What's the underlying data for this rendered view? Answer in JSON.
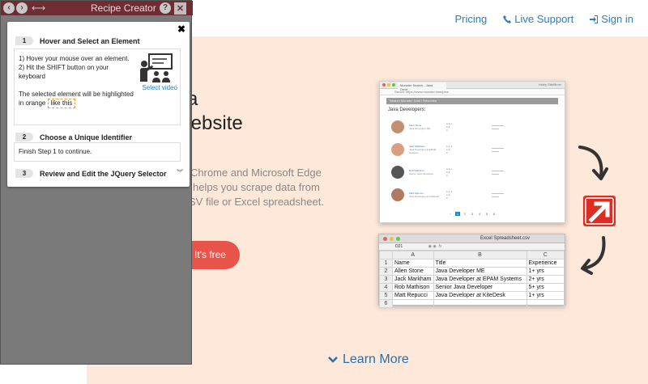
{
  "nav": {
    "pricing": "Pricing",
    "live_support": "Live Support",
    "sign_in": "Sign in"
  },
  "hero": {
    "title_line1": "a",
    "title_line2": "Vebsite",
    "title_line3": ".",
    "sub_line1": "Chrome and Microsoft Edge",
    "sub_line2": "helps you scrape data from",
    "sub_line3": "SV file or Excel spreadsheet.",
    "cta": "It's free",
    "learn_more": "Learn More"
  },
  "mock_browser": {
    "tab": "Monster Search - Java Deve...",
    "tab_right": "Haley SiteMiner",
    "url": "Secure https://www.monster.com/jobs",
    "search": "Search Monster Jobs / Resumes",
    "heading": "Java Developers:",
    "rows": [
      {
        "name": "Allen Stone",
        "title": "Java Developer ME"
      },
      {
        "name": "Jack Markham",
        "title": "Java Developer at EPAM Systems"
      },
      {
        "name": "Rob Mathison",
        "title": "Senior Java Developer"
      },
      {
        "name": "Matt Repucci",
        "title": "Java Developer at KiteDesk"
      }
    ],
    "pages": [
      "1",
      "2",
      "3",
      "4",
      "5",
      "6"
    ]
  },
  "spreadsheet": {
    "window_title": "Excel Spreadsheet.csv",
    "cell_ref": "D21",
    "col_headers": [
      "A",
      "B",
      "C"
    ],
    "rows": [
      {
        "n": "1",
        "a": "Name",
        "b": "Title",
        "c": "Experience"
      },
      {
        "n": "2",
        "a": "Allen Stone",
        "b": "Java Developer ME",
        "c": "1+ yrs"
      },
      {
        "n": "3",
        "a": "Jack Markham",
        "b": "Java Developer at EPAM Systems",
        "c": "2+ yrs"
      },
      {
        "n": "4",
        "a": "Rob Mathison",
        "b": "Senior Java Developer",
        "c": "5+ yrs"
      },
      {
        "n": "5",
        "a": "Matt Repucci",
        "b": "Java Developer at KiteDesk",
        "c": "1+ yrs"
      },
      {
        "n": "6",
        "a": "",
        "b": "",
        "c": ""
      }
    ]
  },
  "recipe_creator": {
    "title": "Recipe Creator",
    "help": "?",
    "step1": {
      "num": "1",
      "heading": "Hover and Select an Element",
      "line1": "1) Hover your mouse over an element.",
      "line2": "2) Hit the SHIFT button on your",
      "line3": "keyboard",
      "line4": "The selected element will be highlighted",
      "line5_pre": "in orange",
      "line5_hl": "like this",
      "select_video": "Select video"
    },
    "step2": {
      "num": "2",
      "heading": "Choose a Unique Identifier",
      "text": "Finish Step 1 to continue."
    },
    "step3": {
      "num": "3",
      "heading": "Review and Edit the JQuery Selector"
    }
  },
  "colors": {
    "titlebar": "#6e2d33",
    "hero_bg": "#fde8da",
    "link": "#2a7fc1",
    "cta": "#e8544a"
  }
}
